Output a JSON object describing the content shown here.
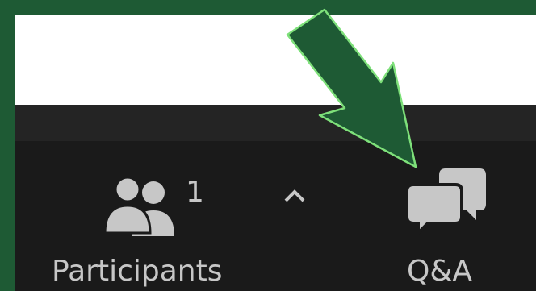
{
  "toolbar": {
    "participants": {
      "label": "Participants",
      "count": "1",
      "icon": "participants-icon"
    },
    "chevron": {
      "icon": "chevron-up-icon"
    },
    "qa": {
      "label": "Q&A",
      "icon": "qa-chat-bubbles-icon"
    }
  },
  "annotation": {
    "icon": "pointer-arrow-icon",
    "color": "#1e5a34",
    "outline": "#7ee07a"
  },
  "colors": {
    "frame": "#1e5a34",
    "toolbar_bg": "#1a1a1a",
    "icon": "#c7c7c7"
  }
}
